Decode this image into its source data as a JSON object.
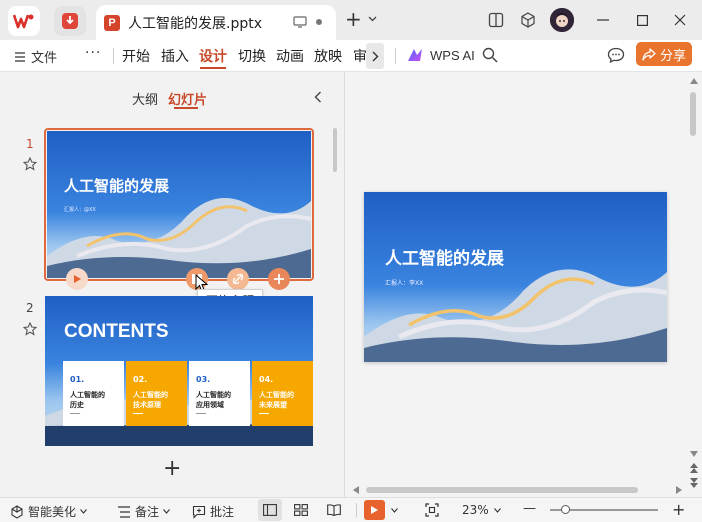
{
  "titlebar": {
    "doc_title": "人工智能的发展.pptx",
    "pp_letter": "P",
    "new_tab_symbol": "+"
  },
  "ribbon": {
    "file_label": "文件",
    "more_label": "···",
    "tabs": [
      "开始",
      "插入",
      "设计",
      "切换",
      "动画",
      "放映",
      "审"
    ],
    "active_tab": "设计",
    "wps_ai_label": "WPS AI",
    "share_label": "分享"
  },
  "panel": {
    "tabs": [
      "大纲",
      "幻灯片"
    ],
    "active_tab": "幻灯片"
  },
  "slides": [
    {
      "number": "1",
      "title": "人工智能的发展",
      "reporter": "汇报人：@XX",
      "tooltip": "更换主题"
    },
    {
      "number": "2",
      "title": "CONTENTS",
      "items": [
        {
          "num": "01.",
          "text1": "人工智能的",
          "text2": "历史"
        },
        {
          "num": "02.",
          "text1": "人工智能的",
          "text2": "技术原理"
        },
        {
          "num": "03.",
          "text1": "人工智能的",
          "text2": "应用领域"
        },
        {
          "num": "04.",
          "text1": "人工智能的",
          "text2": "未来展望"
        }
      ]
    }
  ],
  "main_slide": {
    "title": "人工智能的发展",
    "reporter": "汇报人：李XX"
  },
  "add_slide_symbol": "+",
  "statusbar": {
    "beautify_label": "智能美化",
    "notes_label": "备注",
    "comment_label": "批注",
    "zoom": "23%",
    "minus": "—",
    "plus": "+"
  },
  "colors": {
    "accent": "#c84a2b",
    "share_bg": "#e9742e",
    "slide_blue": "#1f5fc4",
    "contents_yellow": "#f7a800",
    "play_orange": "#e8622d"
  }
}
